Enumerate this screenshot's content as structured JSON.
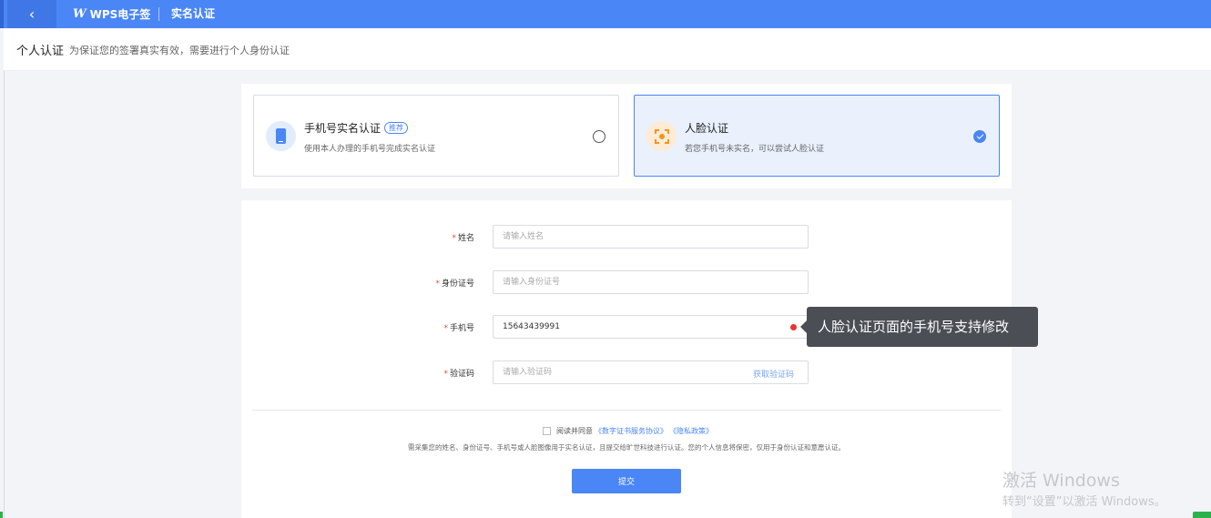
{
  "topbar": {
    "back_icon": "‹",
    "logo_mark": "W",
    "brand": "WPS电子签",
    "title": "实名认证"
  },
  "subheader": {
    "title": "个人认证",
    "desc": "为保证您的签署真实有效，需要进行个人身份认证"
  },
  "methods": [
    {
      "title": "手机号实名认证",
      "badge": "推荐",
      "desc": "使用本人办理的手机号完成实名认证",
      "icon": "phone-icon",
      "selected": false
    },
    {
      "title": "人脸认证",
      "desc": "若您手机号未实名，可以尝试人脸认证",
      "icon": "face-scan-icon",
      "selected": true
    }
  ],
  "form": {
    "name": {
      "label": "姓名",
      "placeholder": "请输入姓名",
      "value": ""
    },
    "id_number": {
      "label": "身份证号",
      "placeholder": "请输入身份证号",
      "value": ""
    },
    "phone": {
      "label": "手机号",
      "placeholder": "",
      "value": "15643439991"
    },
    "code": {
      "label": "验证码",
      "placeholder": "请输入验证码",
      "value": "",
      "action": "获取验证码"
    }
  },
  "tooltip": "人脸认证页面的手机号支持修改",
  "agreement": {
    "prefix": "阅读并同意",
    "link1": "《数字证书服务协议》",
    "link2": "《隐私政策》"
  },
  "notice": "需采集您的姓名、身份证号、手机号或人脸图像用于实名认证，且提交给旷世科技进行认证。您的个人信息将保密，仅用于身份认证和意愿认证。",
  "submit_label": "提交",
  "watermark": {
    "line1": "激活 Windows",
    "line2": "转到“设置”以激活 Windows。"
  },
  "colors": {
    "primary": "#4a86f6",
    "required": "#e5483a",
    "tooltip_bg": "#4b4e55"
  }
}
